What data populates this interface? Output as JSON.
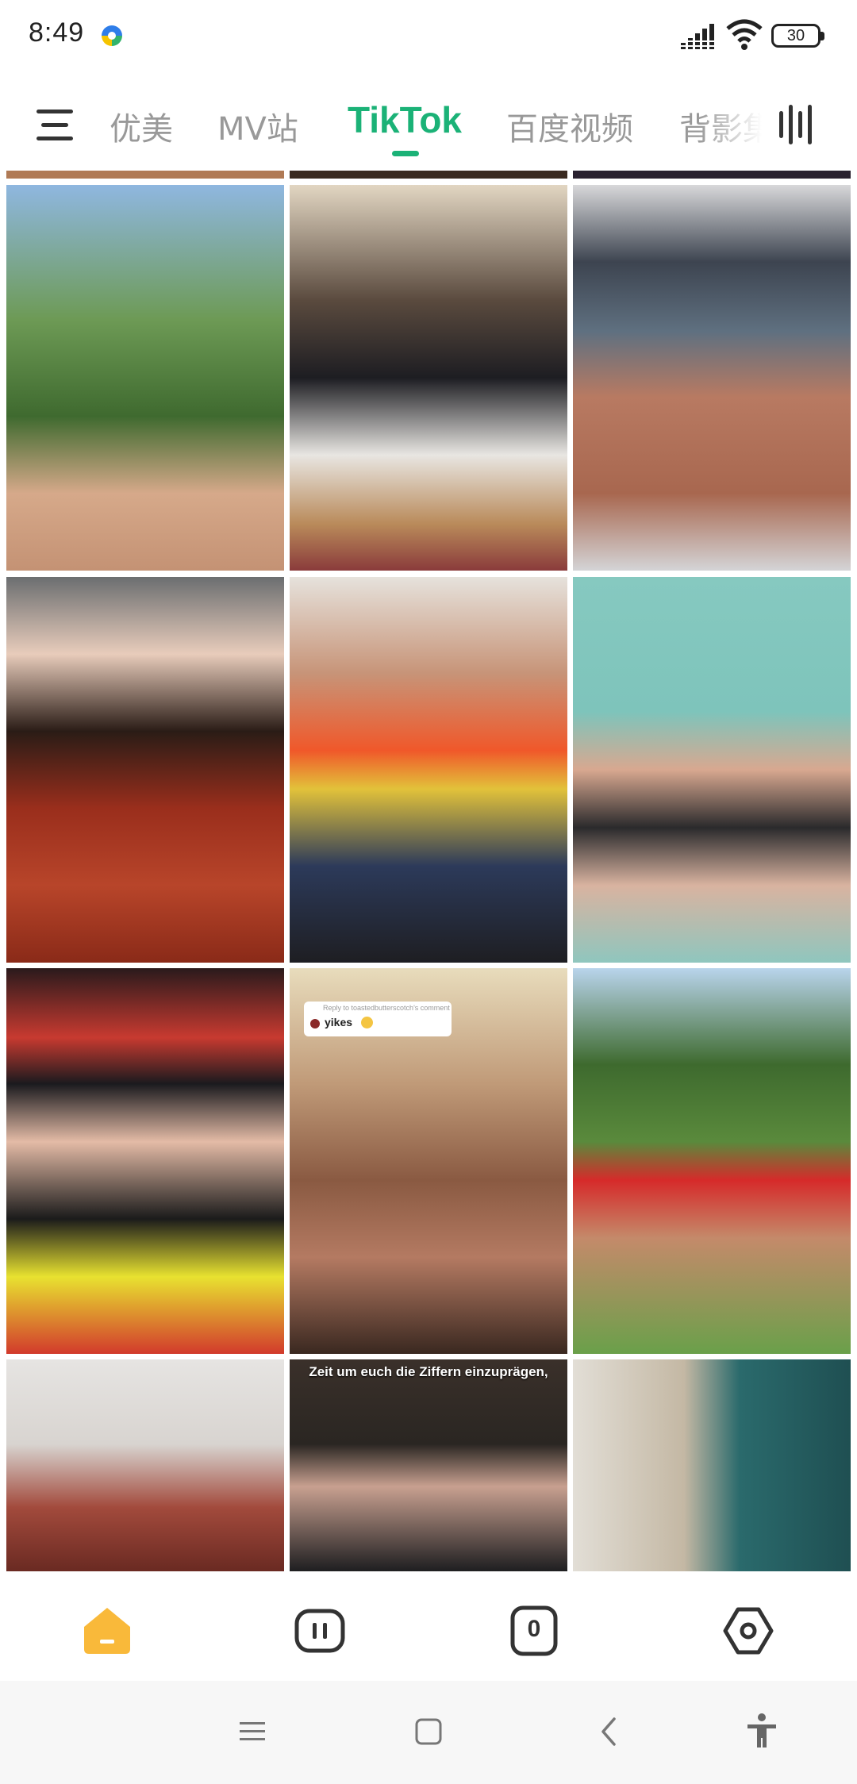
{
  "status_bar": {
    "time": "8:49",
    "battery": "30",
    "icons": [
      "app-icon",
      "signal-icon",
      "wifi-icon",
      "battery-icon"
    ]
  },
  "header": {
    "menu_icon": "menu-icon",
    "tabs": [
      {
        "label": "优美",
        "active": false
      },
      {
        "label": "MV站",
        "active": false
      },
      {
        "label": "TikTok",
        "active": true
      },
      {
        "label": "百度视频",
        "active": false
      },
      {
        "label": "背影集",
        "active": false
      }
    ],
    "right_icon": "vertical-bars-icon",
    "accent_color": "#1bb277"
  },
  "grid": {
    "items": [
      {
        "caption": ""
      },
      {
        "caption": ""
      },
      {
        "caption": ""
      },
      {
        "caption": ""
      },
      {
        "caption": ""
      },
      {
        "caption": ""
      },
      {
        "caption": ""
      },
      {
        "caption": "",
        "reply": {
          "small": "Reply to toastedbutterscotch's comment",
          "text": "yikes"
        }
      },
      {
        "caption": ""
      },
      {
        "caption": ""
      },
      {
        "caption": "Zeit um euch die Ziffern einzuprägen,"
      },
      {
        "caption": ""
      }
    ]
  },
  "bottom_nav": {
    "items": [
      {
        "icon": "home-icon",
        "active": true,
        "color": "#f9b93a"
      },
      {
        "icon": "pause-badge-icon",
        "active": false
      },
      {
        "icon": "zero-badge-icon",
        "active": false,
        "text": "0"
      },
      {
        "icon": "settings-hexagon-icon",
        "active": false
      }
    ]
  },
  "system_nav": {
    "icons": [
      "menu-lines-icon",
      "home-square-icon",
      "back-chevron-icon",
      "accessibility-icon"
    ]
  }
}
